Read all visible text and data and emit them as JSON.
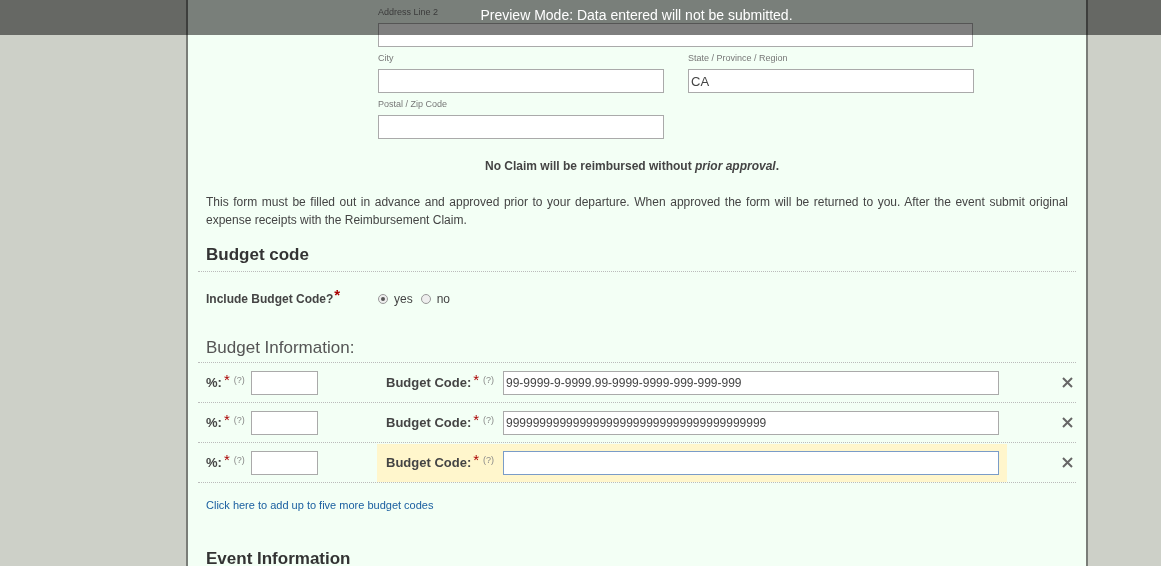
{
  "preview_banner": "Preview Mode: Data entered will not be submitted.",
  "address_rows": [
    [
      {
        "label": "Address Line 2",
        "kind": "wide"
      }
    ],
    [
      {
        "label": "City",
        "kind": "half"
      },
      {
        "label": "State / Province / Region",
        "kind": "half",
        "value": "CA"
      }
    ],
    [
      {
        "label": "Postal / Zip Code",
        "kind": "half"
      }
    ]
  ],
  "notice": "No Claim will be reimbursed without *prior approval*.",
  "instructions": "This form must be filled out in advance and approved prior to your departure. When approved the form will be returned to you. After the event submit original expense  receipts with the Reimbursement Claim.",
  "budget_code_section": {
    "title": "Budget code",
    "question": "Include Budget Code?",
    "required_mark": "*",
    "options": [
      {
        "label": "yes",
        "selected": true
      },
      {
        "label": "no",
        "selected": false
      }
    ]
  },
  "budget_information": {
    "title": "Budget Information:",
    "rows": [
      {
        "percent_label": "%:",
        "required_mark": "*",
        "help": "(?)",
        "code_label": "Budget Code:",
        "code_required_mark": "*",
        "code_help": "(?)",
        "code_value": "99-9999-9-9999.99-9999-9999-999-999-999",
        "focused": false
      },
      {
        "percent_label": "%:",
        "required_mark": "*",
        "help": "(?)",
        "code_label": "Budget Code:",
        "code_required_mark": "*",
        "code_help": "(?)",
        "code_value": "999999999999999999999999999999999999999",
        "focused": false
      },
      {
        "percent_label": "%:",
        "required_mark": "*",
        "help": "(?)",
        "code_label": "Budget Code:",
        "code_required_mark": "*",
        "code_help": "(?)",
        "focused": true
      }
    ],
    "add_link": "Click here to add up to five more budget codes"
  },
  "next_section_title": "Event Information"
}
